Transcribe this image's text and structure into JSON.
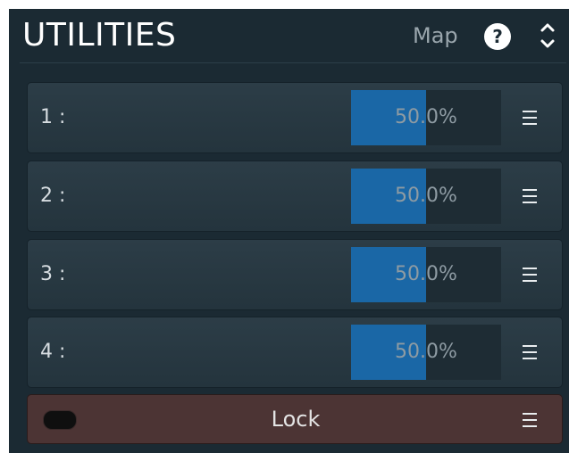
{
  "header": {
    "title": "UTILITIES",
    "map_label": "Map",
    "help_label": "?",
    "icons": [
      "help-icon",
      "collapse-expand-icon"
    ]
  },
  "rows": [
    {
      "label": "1 :",
      "value": "50.0%",
      "fill": 0.5
    },
    {
      "label": "2 :",
      "value": "50.0%",
      "fill": 0.5
    },
    {
      "label": "3 :",
      "value": "50.0%",
      "fill": 0.5
    },
    {
      "label": "4 :",
      "value": "50.0%",
      "fill": 0.5
    }
  ],
  "lock": {
    "label": "Lock",
    "toggled": false
  },
  "colors": {
    "panel_bg": "#1b2a33",
    "slider_fill": "#1a67a6",
    "lock_bg": "#4c3434"
  }
}
